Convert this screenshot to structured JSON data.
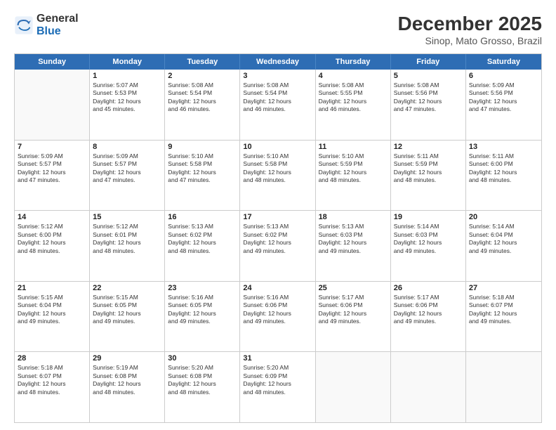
{
  "logo": {
    "general": "General",
    "blue": "Blue"
  },
  "title": "December 2025",
  "location": "Sinop, Mato Grosso, Brazil",
  "days_header": [
    "Sunday",
    "Monday",
    "Tuesday",
    "Wednesday",
    "Thursday",
    "Friday",
    "Saturday"
  ],
  "weeks": [
    [
      {
        "day": "",
        "info": ""
      },
      {
        "day": "1",
        "info": "Sunrise: 5:07 AM\nSunset: 5:53 PM\nDaylight: 12 hours\nand 45 minutes."
      },
      {
        "day": "2",
        "info": "Sunrise: 5:08 AM\nSunset: 5:54 PM\nDaylight: 12 hours\nand 46 minutes."
      },
      {
        "day": "3",
        "info": "Sunrise: 5:08 AM\nSunset: 5:54 PM\nDaylight: 12 hours\nand 46 minutes."
      },
      {
        "day": "4",
        "info": "Sunrise: 5:08 AM\nSunset: 5:55 PM\nDaylight: 12 hours\nand 46 minutes."
      },
      {
        "day": "5",
        "info": "Sunrise: 5:08 AM\nSunset: 5:56 PM\nDaylight: 12 hours\nand 47 minutes."
      },
      {
        "day": "6",
        "info": "Sunrise: 5:09 AM\nSunset: 5:56 PM\nDaylight: 12 hours\nand 47 minutes."
      }
    ],
    [
      {
        "day": "7",
        "info": "Sunrise: 5:09 AM\nSunset: 5:57 PM\nDaylight: 12 hours\nand 47 minutes."
      },
      {
        "day": "8",
        "info": "Sunrise: 5:09 AM\nSunset: 5:57 PM\nDaylight: 12 hours\nand 47 minutes."
      },
      {
        "day": "9",
        "info": "Sunrise: 5:10 AM\nSunset: 5:58 PM\nDaylight: 12 hours\nand 47 minutes."
      },
      {
        "day": "10",
        "info": "Sunrise: 5:10 AM\nSunset: 5:58 PM\nDaylight: 12 hours\nand 48 minutes."
      },
      {
        "day": "11",
        "info": "Sunrise: 5:10 AM\nSunset: 5:59 PM\nDaylight: 12 hours\nand 48 minutes."
      },
      {
        "day": "12",
        "info": "Sunrise: 5:11 AM\nSunset: 5:59 PM\nDaylight: 12 hours\nand 48 minutes."
      },
      {
        "day": "13",
        "info": "Sunrise: 5:11 AM\nSunset: 6:00 PM\nDaylight: 12 hours\nand 48 minutes."
      }
    ],
    [
      {
        "day": "14",
        "info": "Sunrise: 5:12 AM\nSunset: 6:00 PM\nDaylight: 12 hours\nand 48 minutes."
      },
      {
        "day": "15",
        "info": "Sunrise: 5:12 AM\nSunset: 6:01 PM\nDaylight: 12 hours\nand 48 minutes."
      },
      {
        "day": "16",
        "info": "Sunrise: 5:13 AM\nSunset: 6:02 PM\nDaylight: 12 hours\nand 48 minutes."
      },
      {
        "day": "17",
        "info": "Sunrise: 5:13 AM\nSunset: 6:02 PM\nDaylight: 12 hours\nand 49 minutes."
      },
      {
        "day": "18",
        "info": "Sunrise: 5:13 AM\nSunset: 6:03 PM\nDaylight: 12 hours\nand 49 minutes."
      },
      {
        "day": "19",
        "info": "Sunrise: 5:14 AM\nSunset: 6:03 PM\nDaylight: 12 hours\nand 49 minutes."
      },
      {
        "day": "20",
        "info": "Sunrise: 5:14 AM\nSunset: 6:04 PM\nDaylight: 12 hours\nand 49 minutes."
      }
    ],
    [
      {
        "day": "21",
        "info": "Sunrise: 5:15 AM\nSunset: 6:04 PM\nDaylight: 12 hours\nand 49 minutes."
      },
      {
        "day": "22",
        "info": "Sunrise: 5:15 AM\nSunset: 6:05 PM\nDaylight: 12 hours\nand 49 minutes."
      },
      {
        "day": "23",
        "info": "Sunrise: 5:16 AM\nSunset: 6:05 PM\nDaylight: 12 hours\nand 49 minutes."
      },
      {
        "day": "24",
        "info": "Sunrise: 5:16 AM\nSunset: 6:06 PM\nDaylight: 12 hours\nand 49 minutes."
      },
      {
        "day": "25",
        "info": "Sunrise: 5:17 AM\nSunset: 6:06 PM\nDaylight: 12 hours\nand 49 minutes."
      },
      {
        "day": "26",
        "info": "Sunrise: 5:17 AM\nSunset: 6:06 PM\nDaylight: 12 hours\nand 49 minutes."
      },
      {
        "day": "27",
        "info": "Sunrise: 5:18 AM\nSunset: 6:07 PM\nDaylight: 12 hours\nand 49 minutes."
      }
    ],
    [
      {
        "day": "28",
        "info": "Sunrise: 5:18 AM\nSunset: 6:07 PM\nDaylight: 12 hours\nand 48 minutes."
      },
      {
        "day": "29",
        "info": "Sunrise: 5:19 AM\nSunset: 6:08 PM\nDaylight: 12 hours\nand 48 minutes."
      },
      {
        "day": "30",
        "info": "Sunrise: 5:20 AM\nSunset: 6:08 PM\nDaylight: 12 hours\nand 48 minutes."
      },
      {
        "day": "31",
        "info": "Sunrise: 5:20 AM\nSunset: 6:09 PM\nDaylight: 12 hours\nand 48 minutes."
      },
      {
        "day": "",
        "info": ""
      },
      {
        "day": "",
        "info": ""
      },
      {
        "day": "",
        "info": ""
      }
    ]
  ]
}
